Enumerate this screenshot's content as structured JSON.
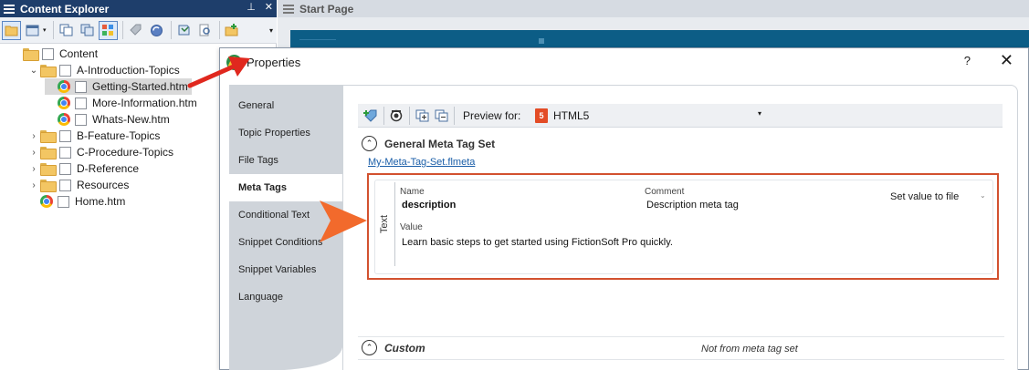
{
  "explorer": {
    "title": "Content Explorer",
    "pin_glyph": "⊥",
    "close_glyph": "✕",
    "toolbar_caret": "▾",
    "tree": [
      {
        "label": "Content",
        "kind": "folder",
        "depth": 0,
        "expander": ""
      },
      {
        "label": "A-Introduction-Topics",
        "kind": "folder",
        "depth": 1,
        "expander": "⌄"
      },
      {
        "label": "Getting-Started.htm",
        "kind": "file",
        "depth": 2,
        "expander": "",
        "selected": true
      },
      {
        "label": "More-Information.htm",
        "kind": "file",
        "depth": 2,
        "expander": ""
      },
      {
        "label": "Whats-New.htm",
        "kind": "file",
        "depth": 2,
        "expander": ""
      },
      {
        "label": "B-Feature-Topics",
        "kind": "folder",
        "depth": 1,
        "expander": "›"
      },
      {
        "label": "C-Procedure-Topics",
        "kind": "folder",
        "depth": 1,
        "expander": "›"
      },
      {
        "label": "D-Reference",
        "kind": "folder",
        "depth": 1,
        "expander": "›"
      },
      {
        "label": "Resources",
        "kind": "folder",
        "depth": 1,
        "expander": "›"
      },
      {
        "label": "Home.htm",
        "kind": "file",
        "depth": 1,
        "expander": ""
      }
    ]
  },
  "start_page": {
    "title": "Start Page"
  },
  "dialog": {
    "title": "Properties",
    "help": "?",
    "close": "✕",
    "nav": [
      {
        "label": "General"
      },
      {
        "label": "Topic Properties"
      },
      {
        "label": "File Tags"
      },
      {
        "label": "Meta Tags",
        "active": true
      },
      {
        "label": "Conditional Text"
      },
      {
        "label": "Snippet Conditions"
      },
      {
        "label": "Snippet Variables"
      },
      {
        "label": "Language"
      }
    ],
    "toolbar": {
      "preview_label": "Preview for:",
      "preview_value": "HTML5",
      "preview_icon": "5",
      "preview_caret": "▾"
    },
    "general_section": {
      "collapse_glyph": "⌃",
      "title": "General Meta Tag Set",
      "link": "My-Meta-Tag-Set.flmeta"
    },
    "meta_tag": {
      "type_label": "Text",
      "name_label": "Name",
      "name_value": "description",
      "comment_label": "Comment",
      "comment_value": "Description meta tag",
      "set_value": "Set value to file",
      "set_caret": "⌄",
      "value_label": "Value",
      "value_text": "Learn basic steps to get started using FictionSoft Pro quickly."
    },
    "custom_section": {
      "collapse_glyph": "⌃",
      "title": "Custom",
      "note": "Not from meta tag set"
    }
  },
  "colors": {
    "title_bar": "#1e3e6b",
    "highlight_box": "#d2512f",
    "red_arrow": "#e0281e",
    "orange_arrow": "#f26a2c",
    "link": "#1a5ea8"
  }
}
